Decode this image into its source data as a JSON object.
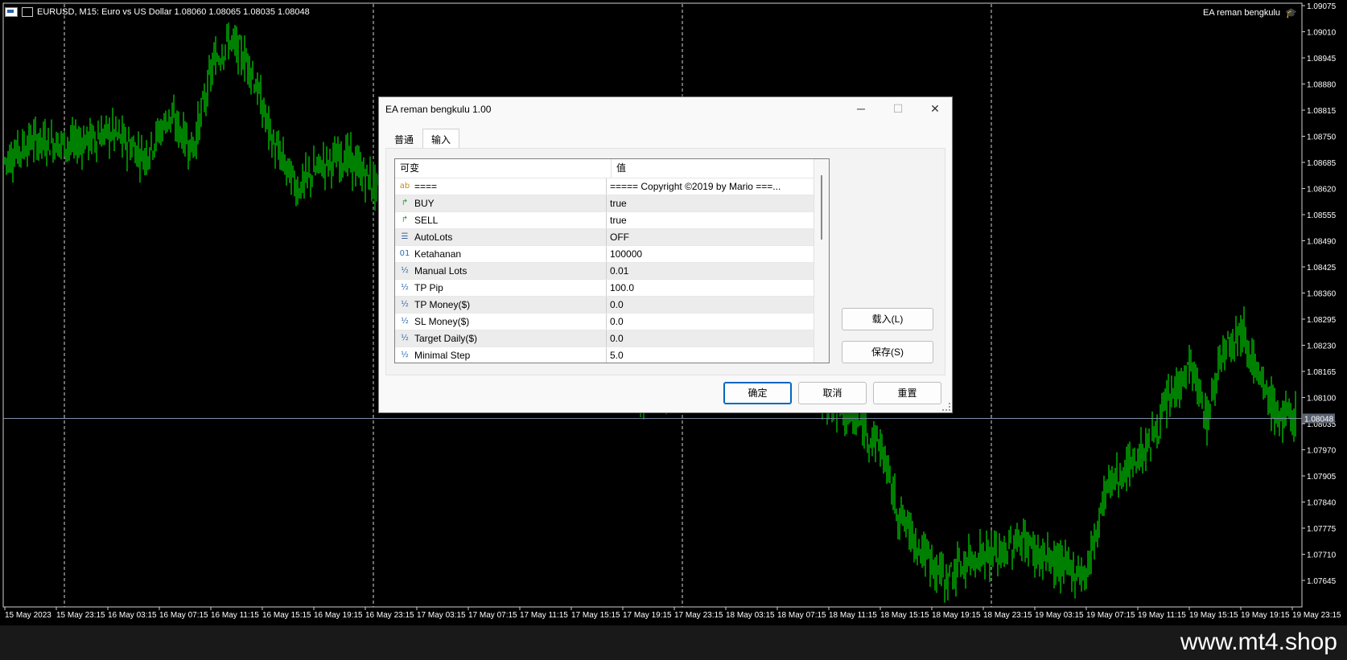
{
  "chart": {
    "symbol_info": "EURUSD, M15:  Euro vs US Dollar  1.08060 1.08065 1.08035 1.08048",
    "ea_name": "EA reman bengkulu",
    "bg_color": "#000000",
    "candle_color": "#00ff00",
    "price_labels": [
      "1.09075",
      "1.09010",
      "1.08945",
      "1.08880",
      "1.08815",
      "1.08750",
      "1.08685",
      "1.08620",
      "1.08555",
      "1.08490",
      "1.08425",
      "1.08360",
      "1.08295",
      "1.08230",
      "1.08165",
      "1.08100",
      "1.08035",
      "1.07970",
      "1.07905",
      "1.07840",
      "1.07775",
      "1.07710",
      "1.07645"
    ],
    "current_price": "1.08048",
    "time_labels": [
      "15 May 2023",
      "15 May 23:15",
      "16 May 03:15",
      "16 May 07:15",
      "16 May 11:15",
      "16 May 15:15",
      "16 May 19:15",
      "16 May 23:15",
      "17 May 03:15",
      "17 May 07:15",
      "17 May 11:15",
      "17 May 15:15",
      "17 May 19:15",
      "17 May 23:15",
      "18 May 03:15",
      "18 May 07:15",
      "18 May 11:15",
      "18 May 15:15",
      "18 May 19:15",
      "18 May 23:15",
      "19 May 03:15",
      "19 May 07:15",
      "19 May 11:15",
      "19 May 15:15",
      "19 May 19:15",
      "19 May 23:15"
    ]
  },
  "footer": {
    "site": "www.mt4.shop"
  },
  "dialog": {
    "title": "EA reman bengkulu 1.00",
    "minimize": "─",
    "maximize": "☐",
    "close": "✕",
    "tabs": [
      "普通",
      "输入"
    ],
    "active_tab": "输入",
    "columns": [
      "可变",
      "值"
    ],
    "rows": [
      {
        "icon": "ab",
        "icon_color": "#c08a2a",
        "name": "====",
        "value": "===== Copyright ©2019 by Mario ===..."
      },
      {
        "icon": "↱",
        "icon_color": "#2a9d2a",
        "name": "BUY",
        "value": "true"
      },
      {
        "icon": "↱",
        "icon_color": "#2a9d2a",
        "name": "SELL",
        "value": "true"
      },
      {
        "icon": "☰",
        "icon_color": "#3a5fa0",
        "name": "AutoLots",
        "value": "OFF"
      },
      {
        "icon": "01",
        "icon_color": "#2a6ab0",
        "name": "Ketahanan",
        "value": "100000"
      },
      {
        "icon": "½",
        "icon_color": "#2a6ab0",
        "name": "Manual Lots",
        "value": "0.01"
      },
      {
        "icon": "½",
        "icon_color": "#2a6ab0",
        "name": "TP Pip",
        "value": "100.0"
      },
      {
        "icon": "½",
        "icon_color": "#2a6ab0",
        "name": "TP Money($)",
        "value": "0.0"
      },
      {
        "icon": "½",
        "icon_color": "#2a6ab0",
        "name": "SL Money($)",
        "value": "0.0"
      },
      {
        "icon": "½",
        "icon_color": "#2a6ab0",
        "name": "Target Daily($)",
        "value": "0.0"
      },
      {
        "icon": "½",
        "icon_color": "#2a6ab0",
        "name": "Minimal Step",
        "value": "5.0"
      }
    ],
    "load_button": "载入(L)",
    "save_button": "保存(S)",
    "ok_button": "确定",
    "cancel_button": "取消",
    "reset_button": "重置"
  }
}
